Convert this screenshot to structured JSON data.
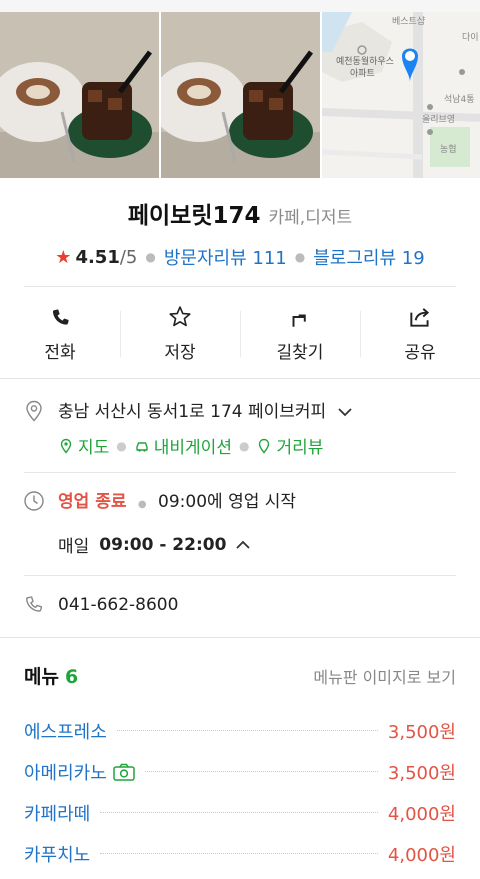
{
  "place": {
    "name": "페이보릿174",
    "category": "카페,디저트",
    "rating": "4.51",
    "rating_max": "/5",
    "visitor_reviews": "방문자리뷰 111",
    "blog_reviews": "블로그리뷰 19"
  },
  "map_thumb": {
    "labels": [
      "베스트샵",
      "예천동월하우스",
      "아파트",
      "석남4통",
      "올리브영",
      "농협",
      "다이"
    ]
  },
  "actions": [
    {
      "label": "전화",
      "icon": "phone-icon"
    },
    {
      "label": "저장",
      "icon": "star-outline-icon"
    },
    {
      "label": "길찾기",
      "icon": "directions-icon"
    },
    {
      "label": "공유",
      "icon": "share-icon"
    }
  ],
  "address": {
    "text": "충남 서산시 동서1로 174 페이브커피",
    "links": [
      "지도",
      "내비게이션",
      "거리뷰"
    ]
  },
  "hours": {
    "status": "영업 종료",
    "next_open": "09:00에 영업 시작",
    "days": "매일",
    "range": "09:00 - 22:00"
  },
  "phone": "041-662-8600",
  "menu": {
    "title": "메뉴",
    "count": "6",
    "board_link": "메뉴판 이미지로 보기",
    "items": [
      {
        "name": "에스프레소",
        "price": "3,500원",
        "has_photo": false
      },
      {
        "name": "아메리카노",
        "price": "3,500원",
        "has_photo": true
      },
      {
        "name": "카페라떼",
        "price": "4,000원",
        "has_photo": false
      },
      {
        "name": "카푸치노",
        "price": "4,000원",
        "has_photo": false
      }
    ]
  },
  "colors": {
    "link_blue": "#1f74c8",
    "accent_green": "#1fa53a",
    "price_red": "#e25545",
    "star_red": "#e8412f"
  }
}
